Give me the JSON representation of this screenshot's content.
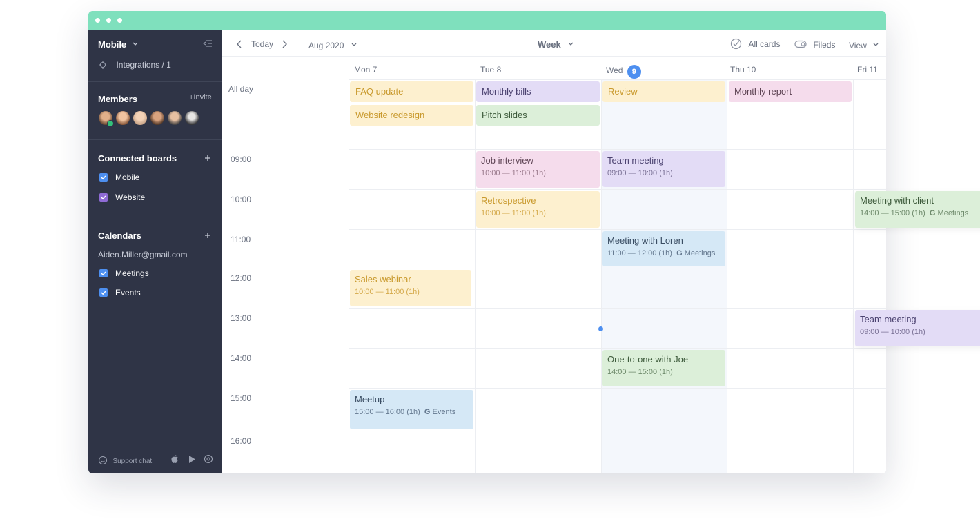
{
  "sidebar": {
    "project": "Mobile",
    "integrations": "Integrations / 1",
    "members_title": "Members",
    "invite": "+Invite",
    "boards_title": "Connected boards",
    "boards": [
      {
        "label": "Mobile",
        "color": "#4d8ff0"
      },
      {
        "label": "Website",
        "color": "#8f6bd6"
      }
    ],
    "calendars_title": "Calendars",
    "account": "Aiden.Miller@gmail.com",
    "calendars": [
      {
        "label": "Meetings",
        "color": "#4d8ff0"
      },
      {
        "label": "Events",
        "color": "#4d8ff0"
      }
    ],
    "support": "Support chat"
  },
  "toolbar": {
    "today": "Today",
    "month": "Aug 2020",
    "view_mode": "Week",
    "all_cards": "All cards",
    "fields": "Fileds",
    "view": "View"
  },
  "days": [
    {
      "name": "Mon 7"
    },
    {
      "name": "Tue 8"
    },
    {
      "name": "Wed",
      "badge": "9"
    },
    {
      "name": "Thu 10"
    },
    {
      "name": "Fri 11"
    }
  ],
  "allday_label": "All day",
  "times": [
    "09:00",
    "10:00",
    "11:00",
    "12:00",
    "13:00",
    "14:00",
    "15:00",
    "16:00"
  ],
  "allday_events": {
    "faq": "FAQ update",
    "website": "Website redesign",
    "bills": "Monthly bills",
    "pitch": "Pitch slides",
    "review": "Review",
    "report": "Monthly report"
  },
  "events": {
    "job": {
      "title": "Job interview",
      "time": "10:00 — 11:00 (1h)"
    },
    "retro": {
      "title": "Retrospective",
      "time": "10:00 — 11:00 (1h)"
    },
    "team_wed": {
      "title": "Team meeting",
      "time": "09:00 — 10:00 (1h)"
    },
    "loren": {
      "title": "Meeting with Loren",
      "time": "11:00 — 12:00 (1h)",
      "cal": "Meetings"
    },
    "client": {
      "title": "Meeting with client",
      "time": "14:00 — 15:00 (1h)",
      "cal": "Meetings"
    },
    "webinar": {
      "title": "Sales webinar",
      "time": "10:00 — 11:00 (1h)"
    },
    "team_fri": {
      "title": "Team meeting",
      "time": "09:00 — 10:00 (1h)"
    },
    "joe": {
      "title": "One-to-one with Joe",
      "time": "14:00 — 15:00 (1h)"
    },
    "meetup": {
      "title": "Meetup",
      "time": "15:00 — 16:00 (1h)",
      "cal": "Events"
    }
  },
  "google_mark": "G",
  "colors": {
    "titlebar": "#7fe0bd",
    "sidebar": "#2f3446",
    "accent": "#4d8ff0"
  }
}
